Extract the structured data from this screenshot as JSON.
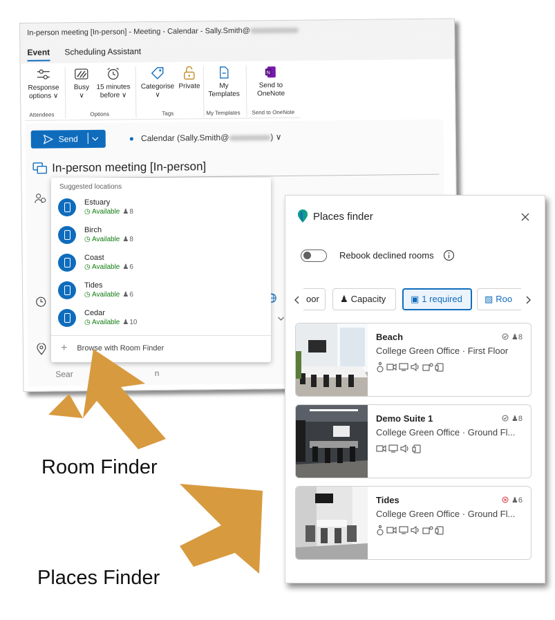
{
  "window": {
    "title": "In-person meeting [In-person] - Meeting - Calendar - Sally.Smith@"
  },
  "tabs": [
    "Event",
    "Scheduling Assistant"
  ],
  "ribbon": {
    "response_options": [
      "Response",
      "options ∨"
    ],
    "busy": [
      "Busy",
      "∨"
    ],
    "reminder": [
      "15 minutes",
      "before ∨"
    ],
    "categorise": [
      "Categorise",
      "∨"
    ],
    "private": "Private",
    "my_templates": [
      "My",
      "Templates"
    ],
    "send_onenote": [
      "Send to",
      "OneNote"
    ],
    "groups": {
      "attendees": "Attendees",
      "options": "Options",
      "tags": "Tags",
      "my_templates": "My Templates",
      "send_to_onenote": "Send to OneNote"
    }
  },
  "compose": {
    "send_label": "Send",
    "calendar_label": "Calendar (Sally.Smith@",
    "calendar_suffix": ") ∨",
    "subject": "In-person meeting [In-person]",
    "search_placeholder_start": "Sear",
    "search_placeholder_end": "n"
  },
  "suggested": {
    "header": "Suggested locations",
    "items": [
      {
        "name": "Estuary",
        "status": "Available",
        "capacity": "8"
      },
      {
        "name": "Birch",
        "status": "Available",
        "capacity": "8"
      },
      {
        "name": "Coast",
        "status": "Available",
        "capacity": "6"
      },
      {
        "name": "Tides",
        "status": "Available",
        "capacity": "6"
      },
      {
        "name": "Cedar",
        "status": "Available",
        "capacity": "10"
      }
    ],
    "browse_label": "Browse with Room Finder"
  },
  "places": {
    "title": "Places finder",
    "rebook_label": "Rebook declined rooms",
    "chips": {
      "floor": "oor",
      "capacity": "Capacity",
      "required": "1 required",
      "room": "Roo"
    },
    "cards": [
      {
        "name": "Beach",
        "location": "College Green Office · First Floor",
        "capacity": "8",
        "status": "available"
      },
      {
        "name": "Demo Suite 1",
        "location": "College Green Office · Ground Fl...",
        "capacity": "8",
        "status": "available"
      },
      {
        "name": "Tides",
        "location": "College Green Office · Ground Fl...",
        "capacity": "6",
        "status": "unavailable"
      }
    ]
  },
  "annotations": {
    "room_finder": "Room Finder",
    "places_finder": "Places Finder"
  },
  "colors": {
    "accent": "#0f6cbd",
    "available": "#107c10",
    "unavailable": "#d13438",
    "arrow": "#d89a3f"
  }
}
